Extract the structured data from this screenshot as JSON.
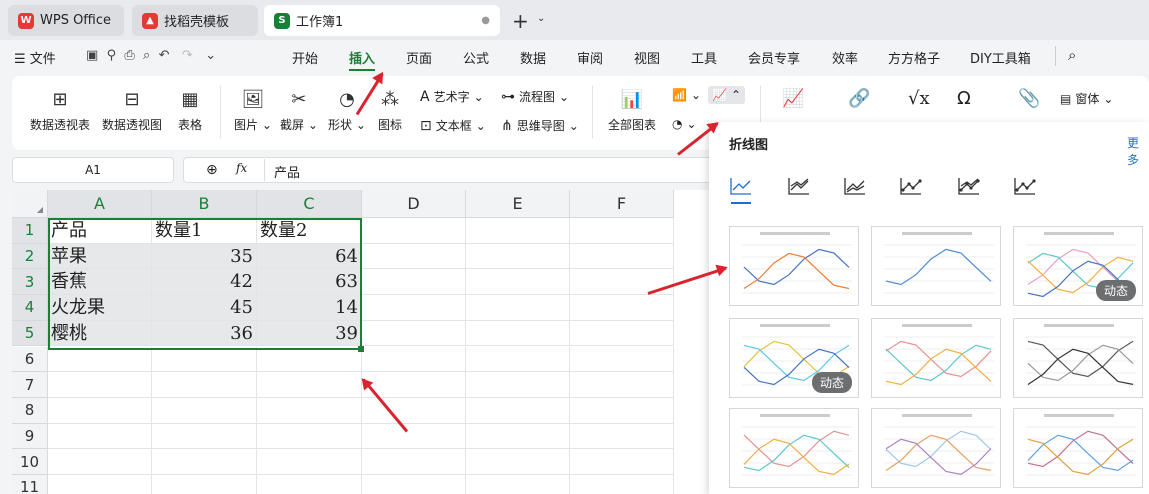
{
  "tabs": [
    {
      "label": "WPS Office",
      "icon": "wps-logo-icon",
      "icon_glyph": "W",
      "color": "#e53935"
    },
    {
      "label": "找稻壳模板",
      "icon": "docer-logo-icon",
      "icon_glyph": "▲",
      "color": "#e53935"
    },
    {
      "label": "工作簿1",
      "icon": "spreadsheet-icon",
      "icon_glyph": "S",
      "color": "#1a7f37"
    }
  ],
  "menu": {
    "file_label": "文件",
    "items": [
      "开始",
      "插入",
      "页面",
      "公式",
      "数据",
      "审阅",
      "视图",
      "工具",
      "会员专享",
      "效率",
      "方方格子",
      "DIY工具箱"
    ],
    "active": "插入"
  },
  "ribbon": {
    "pivot_table": "数据透视表",
    "pivot_chart": "数据透视图",
    "table": "表格",
    "picture": "图片",
    "screenshot": "截屏",
    "shape": "形状",
    "icon": "图标",
    "art_text": "艺术字",
    "text_box": "文本框",
    "flowchart": "流程图",
    "mindmap": "思维导图",
    "all_charts": "全部图表",
    "form": "窗体"
  },
  "formula": {
    "cell_ref": "A1",
    "fx": "fx",
    "content": "产品"
  },
  "sheet": {
    "columns": [
      "A",
      "B",
      "C",
      "D",
      "E",
      "F"
    ],
    "rows": [
      "1",
      "2",
      "3",
      "4",
      "5",
      "6",
      "7",
      "8",
      "9",
      "10",
      "11"
    ],
    "cells": [
      [
        "产品",
        "数量1",
        "数量2"
      ],
      [
        "苹果",
        "35",
        "64"
      ],
      [
        "香蕉",
        "42",
        "63"
      ],
      [
        "火龙果",
        "45",
        "14"
      ],
      [
        "樱桃",
        "36",
        "39"
      ]
    ]
  },
  "panel": {
    "title": "折线图",
    "more": "更多",
    "dynamic_badge": "动态"
  },
  "colors": {
    "accent": "#1a7f37",
    "arrow": "#d9232e"
  }
}
